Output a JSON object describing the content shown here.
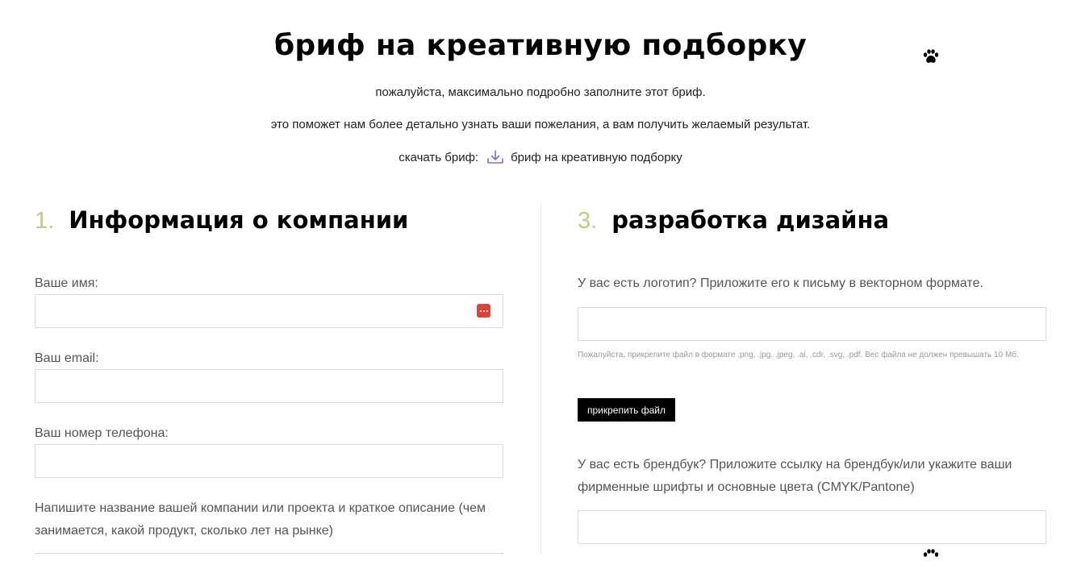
{
  "header": {
    "title": "бриф на креативную подборку",
    "subtitle_1": "пожалуйста, максимально подробно заполните этот бриф.",
    "subtitle_2": "это поможет нам более детально узнать ваши пожелания, а вам получить желаемый результат.",
    "download_label": "скачать бриф:",
    "download_link": "бриф на креативную подборку"
  },
  "section_1": {
    "number": "1.",
    "title": "Информация о компании",
    "fields": [
      {
        "label": "Ваше имя:",
        "value": ""
      },
      {
        "label": "Ваш email:",
        "value": ""
      },
      {
        "label": "Ваш номер телефона:",
        "value": ""
      },
      {
        "label": "Напишите название вашей компании или проекта и краткое описание (чем занимается, какой продукт, сколько лет на рынке)",
        "value": ""
      }
    ]
  },
  "section_3": {
    "number": "3.",
    "title": "разработка дизайна",
    "logo_label": "У вас есть логотип? Приложите его к письму в векторном формате.",
    "logo_value": "",
    "file_hint": "Пожалуйста, прикрепите файл в формате .png, .jpg, .jpeg, .ai, .cdr, .svg, .pdf. Вес файла не должен превышать 10 Мб.",
    "attach_button": "прикрепить файл",
    "brandbook_label": "У вас есть брендбук? Приложите ссылку на брендбук/или укажите ваши фирменные шрифты и основные цвета (CMYK/Pantone)",
    "brandbook_value": ""
  },
  "icons": {
    "paw": "paw-icon",
    "download": "download-icon",
    "autofill": "password-manager-icon"
  },
  "colors": {
    "accent_number": "#b9cf83",
    "download_icon": "#8a6fc7",
    "button_bg": "#000000"
  }
}
